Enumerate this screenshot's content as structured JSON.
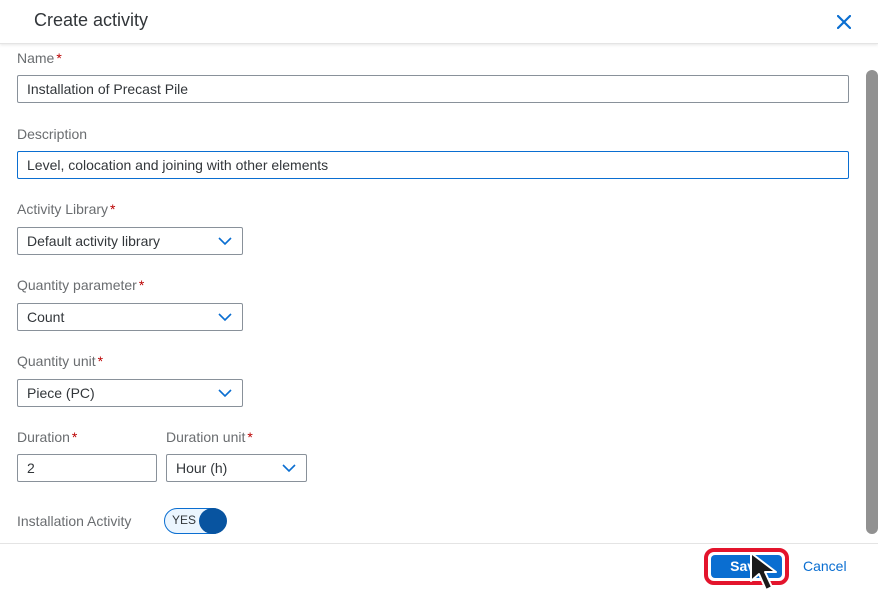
{
  "dialog": {
    "title": "Create activity",
    "close_icon": "close-icon",
    "accent_color": "#0a6ed1"
  },
  "form": {
    "required_marker": "*",
    "name": {
      "label": "Name",
      "value": "Installation of Precast Pile"
    },
    "description": {
      "label": "Description",
      "value": "Level, colocation and joining with other elements"
    },
    "activity_library": {
      "label": "Activity Library",
      "value": "Default activity library"
    },
    "quantity_parameter": {
      "label": "Quantity parameter",
      "value": "Count"
    },
    "quantity_unit": {
      "label": "Quantity unit",
      "value": "Piece (PC)"
    },
    "duration": {
      "label": "Duration",
      "value": "2"
    },
    "duration_unit": {
      "label": "Duration unit",
      "value": "Hour (h)"
    },
    "installation_activity": {
      "label": "Installation Activity",
      "toggle_text": "YES",
      "on": true
    }
  },
  "footer": {
    "save_label": "Save",
    "cancel_label": "Cancel"
  }
}
